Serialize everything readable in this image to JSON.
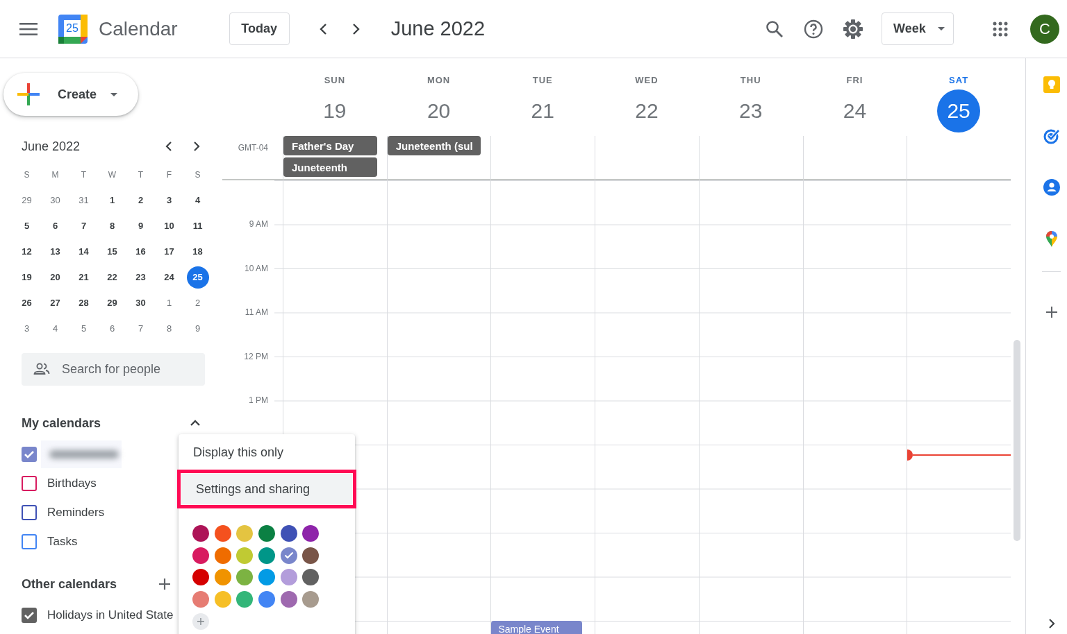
{
  "header": {
    "app_name": "Calendar",
    "logo_day": "25",
    "today_button": "Today",
    "period": "June 2022",
    "view_select": "Week",
    "avatar": "C"
  },
  "create_button": "Create",
  "mini_calendar": {
    "title": "June 2022",
    "weekdays": [
      "S",
      "M",
      "T",
      "W",
      "T",
      "F",
      "S"
    ],
    "weeks": [
      [
        {
          "day": "29",
          "muted": true,
          "selected": false
        },
        {
          "day": "30",
          "muted": true,
          "selected": false
        },
        {
          "day": "31",
          "muted": true,
          "selected": false
        },
        {
          "day": "1",
          "muted": false,
          "selected": false
        },
        {
          "day": "2",
          "muted": false,
          "selected": false
        },
        {
          "day": "3",
          "muted": false,
          "selected": false
        },
        {
          "day": "4",
          "muted": false,
          "selected": false
        }
      ],
      [
        {
          "day": "5",
          "muted": false,
          "selected": false
        },
        {
          "day": "6",
          "muted": false,
          "selected": false
        },
        {
          "day": "7",
          "muted": false,
          "selected": false
        },
        {
          "day": "8",
          "muted": false,
          "selected": false
        },
        {
          "day": "9",
          "muted": false,
          "selected": false
        },
        {
          "day": "10",
          "muted": false,
          "selected": false
        },
        {
          "day": "11",
          "muted": false,
          "selected": false
        }
      ],
      [
        {
          "day": "12",
          "muted": false,
          "selected": false
        },
        {
          "day": "13",
          "muted": false,
          "selected": false
        },
        {
          "day": "14",
          "muted": false,
          "selected": false
        },
        {
          "day": "15",
          "muted": false,
          "selected": false
        },
        {
          "day": "16",
          "muted": false,
          "selected": false
        },
        {
          "day": "17",
          "muted": false,
          "selected": false
        },
        {
          "day": "18",
          "muted": false,
          "selected": false
        }
      ],
      [
        {
          "day": "19",
          "muted": false,
          "selected": false
        },
        {
          "day": "20",
          "muted": false,
          "selected": false
        },
        {
          "day": "21",
          "muted": false,
          "selected": false
        },
        {
          "day": "22",
          "muted": false,
          "selected": false
        },
        {
          "day": "23",
          "muted": false,
          "selected": false
        },
        {
          "day": "24",
          "muted": false,
          "selected": false
        },
        {
          "day": "25",
          "muted": false,
          "selected": true
        }
      ],
      [
        {
          "day": "26",
          "muted": false,
          "selected": false
        },
        {
          "day": "27",
          "muted": false,
          "selected": false
        },
        {
          "day": "28",
          "muted": false,
          "selected": false
        },
        {
          "day": "29",
          "muted": false,
          "selected": false
        },
        {
          "day": "30",
          "muted": false,
          "selected": false
        },
        {
          "day": "1",
          "muted": true,
          "selected": false
        },
        {
          "day": "2",
          "muted": true,
          "selected": false
        }
      ],
      [
        {
          "day": "3",
          "muted": true,
          "selected": false
        },
        {
          "day": "4",
          "muted": true,
          "selected": false
        },
        {
          "day": "5",
          "muted": true,
          "selected": false
        },
        {
          "day": "6",
          "muted": true,
          "selected": false
        },
        {
          "day": "7",
          "muted": true,
          "selected": false
        },
        {
          "day": "8",
          "muted": true,
          "selected": false
        },
        {
          "day": "9",
          "muted": true,
          "selected": false
        }
      ]
    ]
  },
  "search_people": {
    "placeholder": "Search for people"
  },
  "my_calendars": {
    "title": "My calendars",
    "expanded": true,
    "items": [
      {
        "kind": "blurred",
        "checked": true,
        "color": "#7986cb"
      },
      {
        "kind": "named",
        "label": "Birthdays",
        "checked": false,
        "color": "#d81b60"
      },
      {
        "kind": "named",
        "label": "Reminders",
        "checked": false,
        "color": "#3f51b5"
      },
      {
        "kind": "named",
        "label": "Tasks",
        "checked": false,
        "color": "#4285f4"
      }
    ]
  },
  "other_calendars": {
    "title": "Other calendars",
    "items": [
      {
        "kind": "named",
        "label": "Holidays in United State",
        "checked": true,
        "color": "#616161"
      }
    ]
  },
  "week": {
    "timezone": "GMT-04",
    "hours": [
      "9 AM",
      "10 AM",
      "11 AM",
      "12 PM",
      "1 PM"
    ],
    "days": [
      {
        "weekday": "SUN",
        "date": "19",
        "selected": false,
        "current_time": false,
        "all_day_events": [
          "Father's Day",
          "Juneteenth"
        ]
      },
      {
        "weekday": "MON",
        "date": "20",
        "selected": false,
        "current_time": false,
        "all_day_events": [
          "Juneteenth (sul"
        ]
      },
      {
        "weekday": "TUE",
        "date": "21",
        "selected": false,
        "current_time": false,
        "timed_events": [
          "Sample Event"
        ]
      },
      {
        "weekday": "WED",
        "date": "22",
        "selected": false,
        "current_time": false
      },
      {
        "weekday": "THU",
        "date": "23",
        "selected": false,
        "current_time": false
      },
      {
        "weekday": "FRI",
        "date": "24",
        "selected": false,
        "current_time": false
      },
      {
        "weekday": "SAT",
        "date": "25",
        "selected": true,
        "current_time": true
      }
    ]
  },
  "menu": {
    "items": [
      {
        "label": "Display this only",
        "selected": false,
        "highlighted": false
      },
      {
        "label": "Settings and sharing",
        "selected": true,
        "highlighted": true
      }
    ],
    "colors": [
      {
        "color": "#ad1457",
        "selected": false
      },
      {
        "color": "#f4511e",
        "selected": false
      },
      {
        "color": "#e4c441",
        "selected": false
      },
      {
        "color": "#0b8043",
        "selected": false
      },
      {
        "color": "#3f51b5",
        "selected": false
      },
      {
        "color": "#8e24aa",
        "selected": false
      },
      {
        "color": "#d81b60",
        "selected": false
      },
      {
        "color": "#ef6c00",
        "selected": false
      },
      {
        "color": "#c0ca33",
        "selected": false
      },
      {
        "color": "#009688",
        "selected": false
      },
      {
        "color": "#7986cb",
        "selected": true
      },
      {
        "color": "#795548",
        "selected": false
      },
      {
        "color": "#d50000",
        "selected": false
      },
      {
        "color": "#f09300",
        "selected": false
      },
      {
        "color": "#7cb342",
        "selected": false
      },
      {
        "color": "#039be5",
        "selected": false
      },
      {
        "color": "#b39ddb",
        "selected": false
      },
      {
        "color": "#616161",
        "selected": false
      },
      {
        "color": "#e67c73",
        "selected": false
      },
      {
        "color": "#f6bf26",
        "selected": false
      },
      {
        "color": "#33b679",
        "selected": false
      },
      {
        "color": "#4285f4",
        "selected": false
      },
      {
        "color": "#9e69af",
        "selected": false
      },
      {
        "color": "#a79b8e",
        "selected": false
      }
    ]
  }
}
